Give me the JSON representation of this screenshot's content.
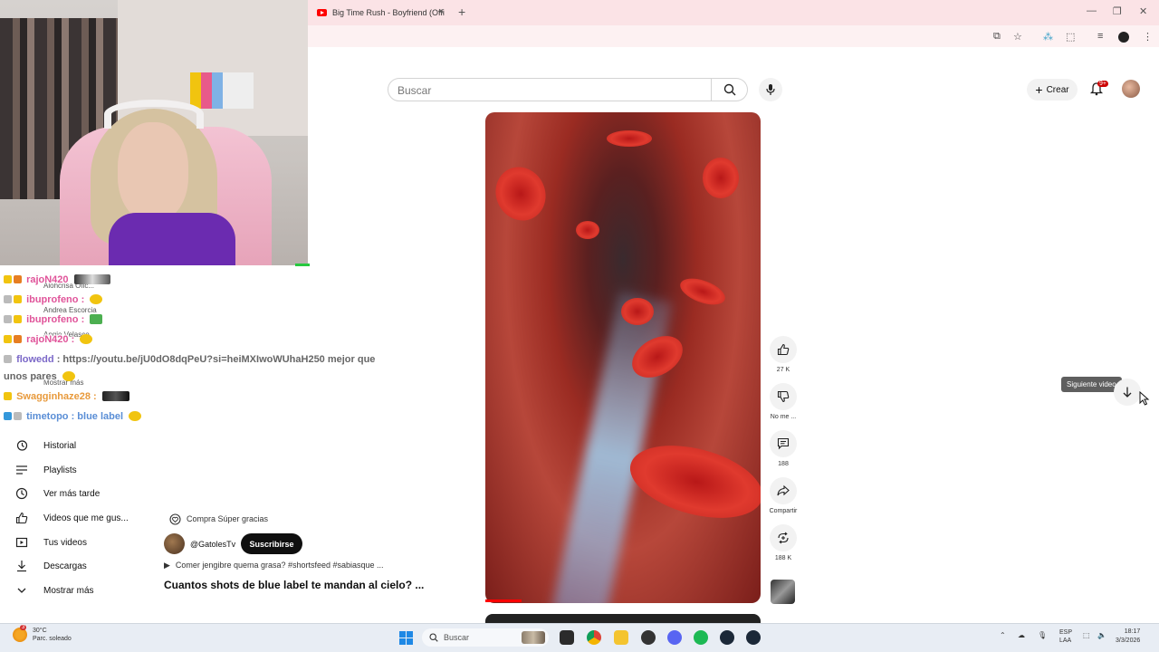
{
  "browser": {
    "tab_title": "Big Time Rush - Boyfriend (Offi",
    "tab_close": "×",
    "new_tab": "+",
    "window_controls": [
      "—",
      "❐",
      "✕"
    ]
  },
  "header": {
    "search_placeholder": "Buscar",
    "create_label": "Crear",
    "notifications_badge": "9+"
  },
  "chat": {
    "messages": [
      {
        "user": "rajoN420",
        "text": ""
      },
      {
        "user": "ibuprofeno",
        "text": ":"
      },
      {
        "user": "ibuprofeno",
        "text": ":"
      },
      {
        "user": "rajoN420",
        "text": ":"
      },
      {
        "user": "flowedd",
        "text": ": https://youtu.be/jU0dO8dqPeU?si=heiMXIwoWUhaH250 mejor que"
      },
      {
        "user": "",
        "text": "unos pares"
      },
      {
        "user": "Swagginhaze28",
        "text": ":"
      },
      {
        "user": "timetopo",
        "text": ": blue label"
      }
    ],
    "ghost_labels": [
      "Alohcrisa Ofic...",
      "Andrea Escorcia",
      "Angie Velasco",
      "Mostrar más"
    ]
  },
  "sidebar": {
    "items": [
      {
        "label": "Historial",
        "icon": "history-icon"
      },
      {
        "label": "Playlists",
        "icon": "playlists-icon"
      },
      {
        "label": "Ver más tarde",
        "icon": "watch-later-icon"
      },
      {
        "label": "Videos que me gus...",
        "icon": "thumbs-up-icon"
      },
      {
        "label": "Tus videos",
        "icon": "your-videos-icon"
      },
      {
        "label": "Descargas",
        "icon": "download-icon"
      },
      {
        "label": "Mostrar más",
        "icon": "chevron-down-icon"
      }
    ]
  },
  "short": {
    "super_thanks": "Compra Súper gracias",
    "channel": "@GatolesTv",
    "subscribe": "Suscribirse",
    "description": "Comer jengibre quema grasa? #shortsfeed #sabiasque ...",
    "title": "Cuantos shots de blue label te mandan al cielo? ...",
    "progress": 0.13
  },
  "actions": {
    "like_count": "27 K",
    "dislike_label": "No me ...",
    "comments_count": "188",
    "share_label": "Compartir",
    "remix_count": "188 K"
  },
  "next_video_tooltip": "Siguiente video",
  "taskbar": {
    "weather_temp": "30°C",
    "weather_desc": "Parc. soleado",
    "weather_badge": "3",
    "search_label": "Buscar",
    "lang_line1": "ESP",
    "lang_line2": "LAA",
    "time": "18:17",
    "date": "3/3/2026"
  },
  "colors": {
    "brand_red": "#ff0000",
    "subscribe_bg": "#0f0f0f",
    "tabbar_bg": "#fbe3e6"
  }
}
